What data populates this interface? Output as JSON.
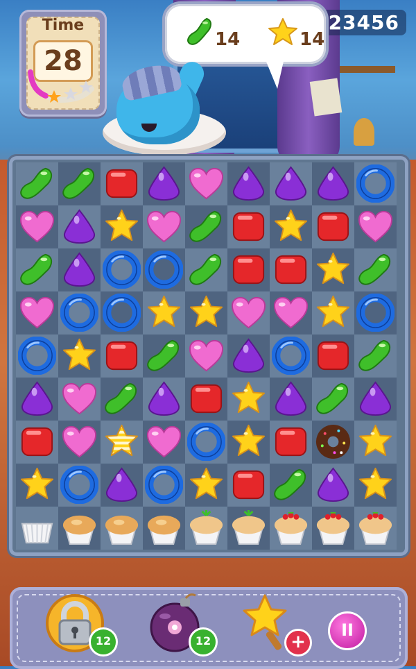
{
  "hud": {
    "time_label": "Time",
    "time_value": "28",
    "score": "123456",
    "goals": [
      {
        "item": "green-jelly",
        "count": "14"
      },
      {
        "item": "yellow-star",
        "count": "14"
      }
    ],
    "time_stars_earned": 1,
    "time_stars_total": 3
  },
  "board": {
    "rows": 9,
    "cols": 9,
    "grid": [
      [
        "jelly",
        "jelly",
        "square",
        "drop",
        "heart",
        "drop",
        "drop",
        "drop",
        "donut"
      ],
      [
        "heart",
        "drop",
        "star",
        "heart",
        "jelly",
        "square",
        "star",
        "square",
        "heart"
      ],
      [
        "jelly",
        "drop",
        "donut",
        "donut",
        "jelly",
        "square",
        "square",
        "star",
        "jelly"
      ],
      [
        "heart",
        "donut",
        "donut",
        "star",
        "star",
        "heart",
        "heart",
        "star",
        "donut"
      ],
      [
        "donut",
        "star",
        "square",
        "jelly",
        "heart",
        "drop",
        "donut",
        "square",
        "jelly"
      ],
      [
        "drop",
        "heart",
        "jelly",
        "drop",
        "square",
        "star",
        "drop",
        "jelly",
        "drop"
      ],
      [
        "square",
        "heart",
        "striped-star",
        "heart",
        "donut",
        "star",
        "square",
        "chocolate-donut",
        "star"
      ],
      [
        "star",
        "donut",
        "drop",
        "donut",
        "star",
        "square",
        "jelly",
        "drop",
        "star"
      ],
      [
        "empty-cupcake",
        "cupcake",
        "cupcake",
        "cupcake",
        "herb-cupcake",
        "herb-cupcake",
        "berry-cupcake",
        "berry-cupcake",
        "berry-cupcake"
      ]
    ]
  },
  "boosters": [
    {
      "name": "lock",
      "count": "12"
    },
    {
      "name": "bomb",
      "count": "12"
    },
    {
      "name": "star-wand",
      "count": "+"
    }
  ],
  "pause_label": "II",
  "colors": {
    "jelly": "#3fbf2a",
    "square": "#e5272a",
    "drop": "#8a2fd6",
    "heart": "#f06bd0",
    "donut": "#1e6be0",
    "star": "#ffd21a"
  }
}
